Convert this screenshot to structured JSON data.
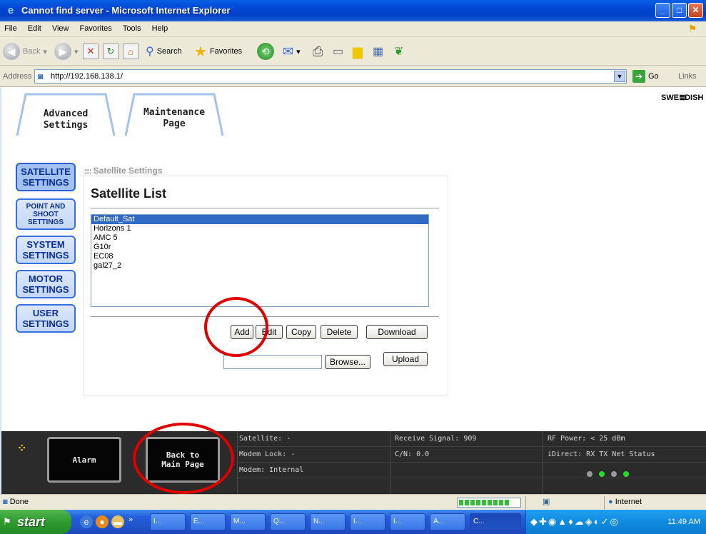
{
  "window": {
    "title": "Cannot find server - Microsoft Internet Explorer",
    "controls": [
      "_",
      "□",
      "✕"
    ]
  },
  "menu": {
    "items": [
      "File",
      "Edit",
      "View",
      "Favorites",
      "Tools",
      "Help"
    ]
  },
  "toolbar": {
    "back_label": "Back",
    "search_label": "Search",
    "favorites_label": "Favorites"
  },
  "address": {
    "label": "Address",
    "url": "http://192.168.138.1/",
    "go_label": "Go",
    "links_label": "Links"
  },
  "tabs": [
    {
      "label_line1": "Advanced",
      "label_line2": "Settings"
    },
    {
      "label_line1": "Maintenance",
      "label_line2": "Page"
    }
  ],
  "brand": {
    "left": "SWE",
    "right": "DISH"
  },
  "sidebar": {
    "items": [
      {
        "line1": "SATELLITE",
        "line2": "SETTINGS",
        "line3": ""
      },
      {
        "line1": "POINT AND",
        "line2": "SHOOT",
        "line3": "SETTINGS"
      },
      {
        "line1": "SYSTEM",
        "line2": "SETTINGS",
        "line3": ""
      },
      {
        "line1": "MOTOR",
        "line2": "SETTINGS",
        "line3": ""
      },
      {
        "line1": "USER",
        "line2": "SETTINGS",
        "line3": ""
      }
    ]
  },
  "breadcrumb": {
    "dots": "::::",
    "text": "Satellite Settings"
  },
  "panel": {
    "title": "Satellite List",
    "list": [
      "Default_Sat",
      "Horizons 1",
      "AMC 5",
      "G10r",
      "EC08",
      "gal27_2"
    ],
    "selected_index": 0,
    "buttons": {
      "add": "Add",
      "edit": "Edit",
      "copy": "Copy",
      "delete": "Delete",
      "download": "Download",
      "browse": "Browse...",
      "upload": "Upload"
    },
    "file_value": ""
  },
  "status": {
    "alarm_label": "Alarm",
    "back_line1": "Back to",
    "back_line2": "Main Page",
    "satellite": "Satellite:  -",
    "modem_lock": "Modem Lock:  -",
    "modem": "Modem:  Internal",
    "receive_signal": "Receive Signal:  909",
    "cn": "C/N:  0.0",
    "rf_power": "RF Power:  < 25 dBm",
    "idirect": "iDirect: RX TX  Net Status",
    "led_colors": [
      "#9a9a9a",
      "#22dd22",
      "#9a9a9a",
      "#22dd22"
    ]
  },
  "ie_status": {
    "done": "Done",
    "progress": 0.85,
    "zone": "Internet"
  },
  "taskbar": {
    "start": "start",
    "tasks": [
      "I...",
      "E...",
      "M...",
      "Q...",
      "N...",
      "I...",
      "I...",
      "A...",
      "C..."
    ],
    "clock": "11:49 AM"
  },
  "colors": {
    "accent": "#3a6fe0",
    "annotation": "#e10000",
    "status_bg": "#2b2b2b"
  }
}
